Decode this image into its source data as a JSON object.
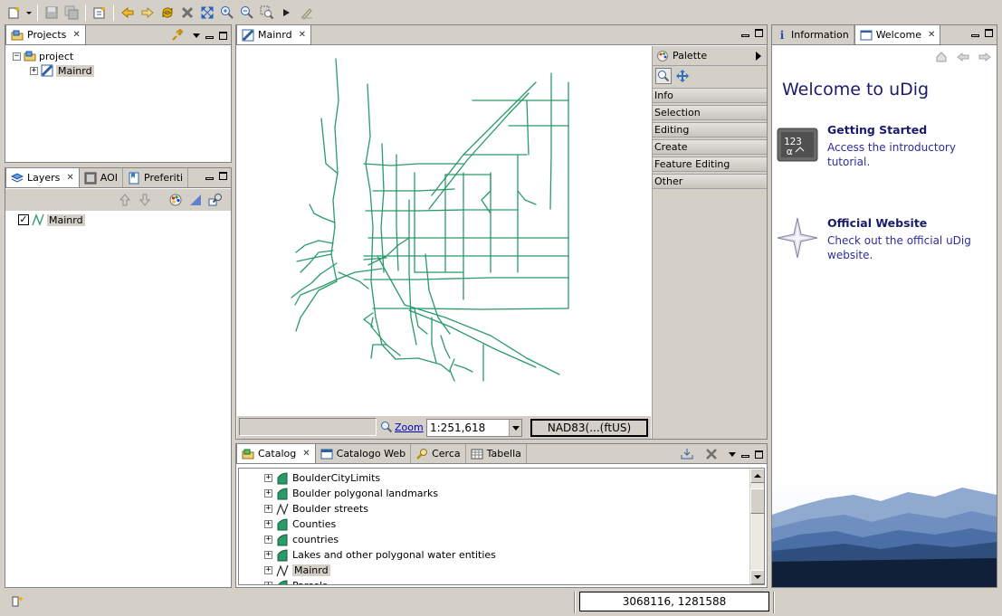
{
  "toolbar": {
    "items": [
      "new-icon",
      "save-icon",
      "save-all-icon",
      "import-icon",
      "back-icon",
      "forward-icon",
      "refresh-icon",
      "stop-icon",
      "zoom-extent-icon",
      "zoom-in-icon",
      "zoom-out-icon",
      "zoom-box-icon",
      "next-icon",
      "edit-icon"
    ]
  },
  "projects": {
    "tab_label": "Projects",
    "root": "project",
    "child": "Mainrd"
  },
  "layers": {
    "tabs": [
      "Layers",
      "AOI",
      "Preferiti"
    ],
    "items": [
      "Mainrd"
    ]
  },
  "map": {
    "tab_label": "Mainrd",
    "zoom_label": "Zoom",
    "scale": "1:251,618",
    "crs": "NAD83(...(ftUS)",
    "line_color": "#2a9a6a"
  },
  "palette": {
    "title": "Palette",
    "drawers": [
      "Info",
      "Selection",
      "Editing",
      "Create",
      "Feature Editing",
      "Other"
    ]
  },
  "catalog": {
    "tabs": [
      "Catalog",
      "Catalogo Web",
      "Cerca",
      "Tabella"
    ],
    "items": [
      {
        "label": "BoulderCityLimits",
        "kind": "polygon"
      },
      {
        "label": "Boulder polygonal landmarks",
        "kind": "polygon"
      },
      {
        "label": "Boulder streets",
        "kind": "line"
      },
      {
        "label": "Counties",
        "kind": "polygon"
      },
      {
        "label": "countries",
        "kind": "polygon"
      },
      {
        "label": "Lakes and other polygonal water entities",
        "kind": "polygon"
      },
      {
        "label": "Mainrd",
        "kind": "line"
      },
      {
        "label": "Parcels",
        "kind": "polygon"
      }
    ]
  },
  "welcome_view": {
    "tabs": [
      "Information",
      "Welcome"
    ],
    "title": "Welcome to uDig",
    "links": [
      {
        "title": "Getting Started",
        "desc_line1": "Access the introductory",
        "desc_line2": "tutorial."
      },
      {
        "title": "Official Website",
        "desc_line1": "Check out the official uDig",
        "desc_line2": "website."
      }
    ]
  },
  "status": {
    "coordinates": "3068116, 1281588"
  }
}
